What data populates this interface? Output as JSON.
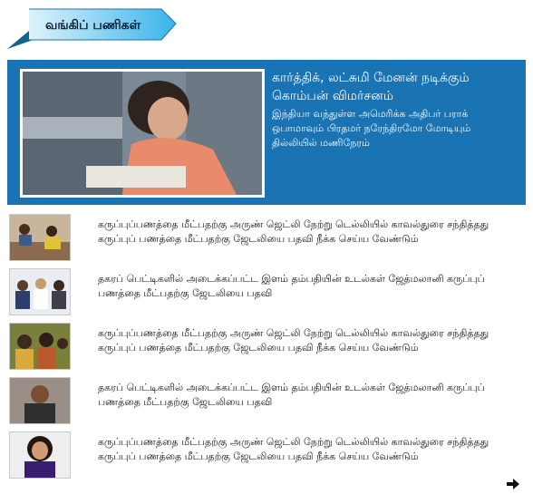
{
  "section": {
    "title": "வங்கிப் பணிகள்"
  },
  "feature": {
    "headline": "கார்த்திக், லட்சுமி மேனன் நடிக்கும் கொம்பன் விமர்சனம்",
    "summary": "இந்தியா வந்துள்ள அமெரிக்க அதிபர் பராக் ஒபாமாவும் பிரதமர் நரேந்திரமோ மோடியும் தில்லியில் மணிநேரம்"
  },
  "list": [
    {
      "text": "கருப்புப்பணத்தை மீட்பதற்கு அருண் ஜெட்லி நேற்று டெல்லியில் காவல்துரை சந்தித்தது கருப்புப் பணத்தை மீட்பதற்கு ஜேடலியை பதவி நீக்க செய்ய வேண்டும்"
    },
    {
      "text": "தகரப் பெட்டிகளில் அடைக்கப்பட்ட இளம் தம்பதியின் உடல்கள் ஜேத்மலானி கருப்புப் பணத்தை மீட்பதற்கு ஜேடலியை பதவி"
    },
    {
      "text": "கருப்புப்பணத்தை மீட்பதற்கு அருண் ஜெட்லி நேற்று டெல்லியில் காவல்துரை சந்தித்தது கருப்புப் பணத்தை மீட்பதற்கு ஜேடலியை பதவி நீக்க செய்ய வேண்டும்"
    },
    {
      "text": "தகரப் பெட்டிகளில் அடைக்கப்பட்ட இளம் தம்பதியின் உடல்கள் ஜேத்மலானி கருப்புப் பணத்தை மீட்பதற்கு ஜேடலியை பதவி"
    },
    {
      "text": "கருப்புப்பணத்தை மீட்பதற்கு அருண் ஜெட்லி நேற்று டெல்லியில் காவல்துரை சந்தித்தது கருப்புப் பணத்தை மீட்பதற்கு ஜேடலியை பதவி நீக்க செய்ய வேண்டும்"
    }
  ],
  "icons": {
    "more": "arrow-right-icon"
  },
  "colors": {
    "feature_bg": "#1a73b2",
    "ribbon": "#3fb6ea"
  }
}
